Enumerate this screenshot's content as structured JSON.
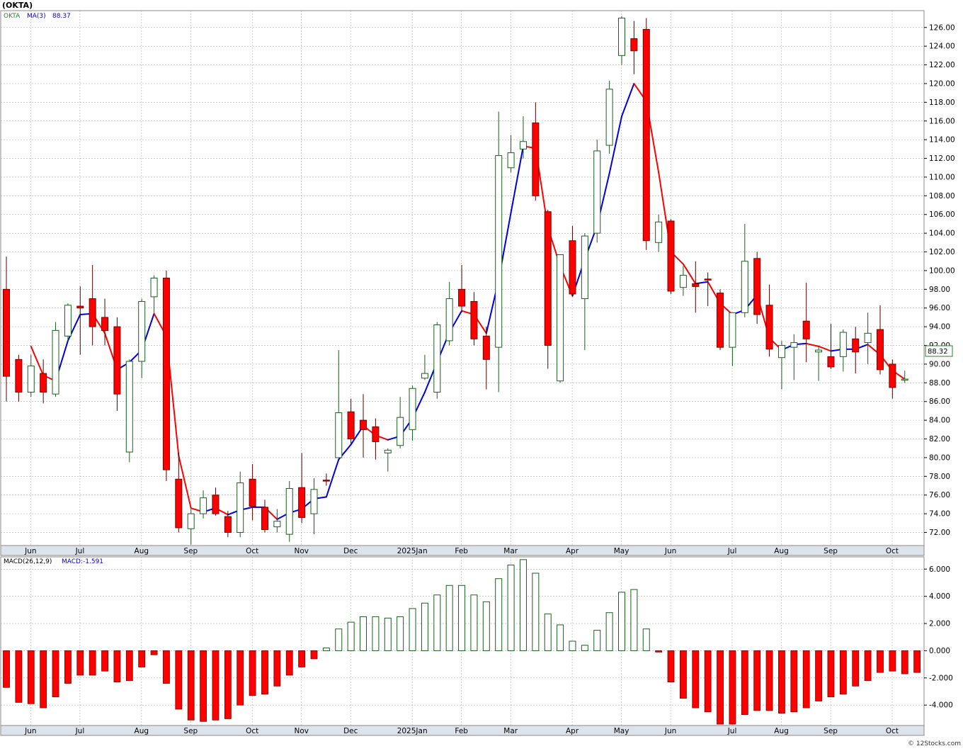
{
  "header": {
    "symbol_title": "(OKTA)"
  },
  "footer": {
    "copyright": "© 12Stocks.com"
  },
  "colors": {
    "up_body_fill": "#ffffff",
    "up_stroke": "#1b5e20",
    "down_fill": "#ff0000",
    "down_stroke": "#7a0000",
    "ma_up": "#0000dd",
    "ma_down": "#ff0000",
    "grid": "#aaaaaa",
    "macd_pos_stroke": "#1b5e20",
    "macd_neg_fill": "#ff0000",
    "price_box": "#2e7d32"
  },
  "chart_data": [
    {
      "type": "candlestick",
      "title": "(OKTA)",
      "legend": {
        "symbol": "OKTA",
        "ma_label": "MA(3)",
        "ma_value": "88.37"
      },
      "last_price_label": "88.32",
      "ylim": [
        70.6,
        127.8
      ],
      "y_ticks": [
        "72.00",
        "74.00",
        "76.00",
        "78.00",
        "80.00",
        "82.00",
        "84.00",
        "86.00",
        "88.00",
        "90.00",
        "92.00",
        "94.00",
        "96.00",
        "98.00",
        "100.00",
        "102.00",
        "104.00",
        "106.00",
        "108.00",
        "110.00",
        "112.00",
        "114.00",
        "116.00",
        "118.00",
        "120.00",
        "122.00",
        "124.00",
        "126.00"
      ],
      "x_labels": [
        {
          "label": "Jun",
          "index": 1
        },
        {
          "label": "Jul",
          "index": 5
        },
        {
          "label": "Aug",
          "index": 10
        },
        {
          "label": "Sep",
          "index": 14
        },
        {
          "label": "Oct",
          "index": 19
        },
        {
          "label": "Nov",
          "index": 23
        },
        {
          "label": "Dec",
          "index": 27
        },
        {
          "label": "2025Jan",
          "index": 32
        },
        {
          "label": "Feb",
          "index": 36
        },
        {
          "label": "Mar",
          "index": 40
        },
        {
          "label": "Apr",
          "index": 45
        },
        {
          "label": "May",
          "index": 49
        },
        {
          "label": "Jun",
          "index": 53
        },
        {
          "label": "Jul",
          "index": 58
        },
        {
          "label": "Aug",
          "index": 62
        },
        {
          "label": "Sep",
          "index": 66
        },
        {
          "label": "Oct",
          "index": 71
        }
      ],
      "candles": [
        {
          "o": 98.0,
          "h": 101.5,
          "l": 86.0,
          "c": 88.7
        },
        {
          "o": 90.5,
          "h": 91.0,
          "l": 86.0,
          "c": 87.0
        },
        {
          "o": 87.0,
          "h": 91.0,
          "l": 86.5,
          "c": 89.8
        },
        {
          "o": 89.0,
          "h": 90.5,
          "l": 85.8,
          "c": 87.0
        },
        {
          "o": 86.8,
          "h": 94.5,
          "l": 86.5,
          "c": 93.6
        },
        {
          "o": 93.0,
          "h": 96.5,
          "l": 92.5,
          "c": 96.3
        },
        {
          "o": 96.2,
          "h": 98.3,
          "l": 91.0,
          "c": 96.0
        },
        {
          "o": 97.0,
          "h": 100.6,
          "l": 92.0,
          "c": 94.0
        },
        {
          "o": 95.0,
          "h": 97.0,
          "l": 92.0,
          "c": 93.6
        },
        {
          "o": 94.0,
          "h": 95.0,
          "l": 85.0,
          "c": 86.8
        },
        {
          "o": 80.6,
          "h": 90.5,
          "l": 79.5,
          "c": 90.3
        },
        {
          "o": 90.3,
          "h": 97.0,
          "l": 88.5,
          "c": 96.7
        },
        {
          "o": 97.2,
          "h": 99.5,
          "l": 95.5,
          "c": 99.2
        },
        {
          "o": 99.2,
          "h": 100.0,
          "l": 77.5,
          "c": 78.7
        },
        {
          "o": 77.7,
          "h": 80.5,
          "l": 72.0,
          "c": 72.5
        },
        {
          "o": 72.4,
          "h": 74.5,
          "l": 70.7,
          "c": 74.0
        },
        {
          "o": 74.0,
          "h": 76.5,
          "l": 73.5,
          "c": 75.7
        },
        {
          "o": 76.0,
          "h": 76.8,
          "l": 73.8,
          "c": 74.0
        },
        {
          "o": 73.7,
          "h": 74.3,
          "l": 71.5,
          "c": 72.0
        },
        {
          "o": 72.0,
          "h": 78.5,
          "l": 71.5,
          "c": 77.3
        },
        {
          "o": 77.7,
          "h": 79.3,
          "l": 73.3,
          "c": 74.8
        },
        {
          "o": 74.7,
          "h": 75.5,
          "l": 72.0,
          "c": 72.3
        },
        {
          "o": 72.6,
          "h": 74.5,
          "l": 72.0,
          "c": 73.2
        },
        {
          "o": 71.8,
          "h": 77.5,
          "l": 71.0,
          "c": 76.7
        },
        {
          "o": 76.8,
          "h": 80.5,
          "l": 73.0,
          "c": 73.6
        },
        {
          "o": 74.0,
          "h": 77.8,
          "l": 71.8,
          "c": 76.6
        },
        {
          "o": 77.6,
          "h": 78.3,
          "l": 77.0,
          "c": 77.5
        },
        {
          "o": 80.0,
          "h": 91.5,
          "l": 80.0,
          "c": 84.8
        },
        {
          "o": 84.9,
          "h": 86.3,
          "l": 81.5,
          "c": 82.0
        },
        {
          "o": 84.0,
          "h": 86.8,
          "l": 80.0,
          "c": 83.0
        },
        {
          "o": 83.3,
          "h": 84.2,
          "l": 79.8,
          "c": 81.7
        },
        {
          "o": 80.5,
          "h": 81.0,
          "l": 78.5,
          "c": 80.8
        },
        {
          "o": 81.3,
          "h": 86.5,
          "l": 81.0,
          "c": 84.3
        },
        {
          "o": 83.0,
          "h": 87.7,
          "l": 81.8,
          "c": 87.4
        },
        {
          "o": 88.5,
          "h": 91.0,
          "l": 88.3,
          "c": 89.0
        },
        {
          "o": 87.0,
          "h": 94.5,
          "l": 86.3,
          "c": 94.2
        },
        {
          "o": 92.5,
          "h": 98.8,
          "l": 92.0,
          "c": 97.0
        },
        {
          "o": 98.0,
          "h": 100.6,
          "l": 95.5,
          "c": 96.2
        },
        {
          "o": 96.7,
          "h": 97.7,
          "l": 92.0,
          "c": 92.7
        },
        {
          "o": 93.0,
          "h": 94.0,
          "l": 87.3,
          "c": 90.5
        },
        {
          "o": 91.8,
          "h": 117.0,
          "l": 87.0,
          "c": 112.3
        },
        {
          "o": 111.0,
          "h": 114.5,
          "l": 110.5,
          "c": 112.6
        },
        {
          "o": 113.0,
          "h": 116.5,
          "l": 112.0,
          "c": 113.8
        },
        {
          "o": 115.8,
          "h": 118.0,
          "l": 107.5,
          "c": 108.0
        },
        {
          "o": 106.3,
          "h": 106.5,
          "l": 89.5,
          "c": 92.0
        },
        {
          "o": 88.2,
          "h": 101.5,
          "l": 88.0,
          "c": 101.7
        },
        {
          "o": 103.2,
          "h": 104.8,
          "l": 97.2,
          "c": 97.5
        },
        {
          "o": 97.0,
          "h": 104.0,
          "l": 91.5,
          "c": 103.7
        },
        {
          "o": 104.0,
          "h": 114.0,
          "l": 103.0,
          "c": 112.8
        },
        {
          "o": 113.4,
          "h": 120.3,
          "l": 112.5,
          "c": 119.4
        },
        {
          "o": 123.0,
          "h": 127.2,
          "l": 122.0,
          "c": 127.0
        },
        {
          "o": 124.8,
          "h": 126.7,
          "l": 121.0,
          "c": 123.5
        },
        {
          "o": 125.8,
          "h": 127.0,
          "l": 102.2,
          "c": 103.2
        },
        {
          "o": 103.0,
          "h": 106.0,
          "l": 102.0,
          "c": 105.2
        },
        {
          "o": 105.3,
          "h": 105.5,
          "l": 97.5,
          "c": 97.8
        },
        {
          "o": 98.2,
          "h": 100.5,
          "l": 97.3,
          "c": 99.5
        },
        {
          "o": 98.6,
          "h": 101.0,
          "l": 95.5,
          "c": 98.3
        },
        {
          "o": 99.1,
          "h": 99.8,
          "l": 96.2,
          "c": 99.0
        },
        {
          "o": 97.6,
          "h": 98.0,
          "l": 91.5,
          "c": 91.8
        },
        {
          "o": 91.8,
          "h": 95.2,
          "l": 89.8,
          "c": 95.5
        },
        {
          "o": 95.5,
          "h": 105.0,
          "l": 95.0,
          "c": 101.0
        },
        {
          "o": 101.3,
          "h": 102.0,
          "l": 94.3,
          "c": 95.3
        },
        {
          "o": 96.3,
          "h": 98.5,
          "l": 90.8,
          "c": 91.6
        },
        {
          "o": 90.7,
          "h": 92.5,
          "l": 87.3,
          "c": 92.0
        },
        {
          "o": 91.8,
          "h": 93.2,
          "l": 88.3,
          "c": 92.3
        },
        {
          "o": 94.6,
          "h": 98.7,
          "l": 90.2,
          "c": 92.7
        },
        {
          "o": 91.3,
          "h": 92.0,
          "l": 88.2,
          "c": 91.5
        },
        {
          "o": 90.8,
          "h": 94.3,
          "l": 89.5,
          "c": 89.7
        },
        {
          "o": 90.8,
          "h": 93.7,
          "l": 89.2,
          "c": 93.4
        },
        {
          "o": 92.7,
          "h": 94.0,
          "l": 89.0,
          "c": 91.3
        },
        {
          "o": 92.3,
          "h": 95.5,
          "l": 90.0,
          "c": 93.3
        },
        {
          "o": 93.7,
          "h": 96.3,
          "l": 88.9,
          "c": 89.4
        },
        {
          "o": 90.0,
          "h": 90.5,
          "l": 86.3,
          "c": 87.5
        },
        {
          "o": 88.3,
          "h": 89.3,
          "l": 88.0,
          "c": 88.4
        }
      ],
      "ma": [
        null,
        null,
        91.9,
        88.8,
        88.2,
        92.5,
        95.3,
        95.4,
        93.3,
        89.4,
        90.2,
        91.5,
        95.4,
        93.0,
        80.2,
        74.6,
        74.2,
        74.6,
        73.9,
        74.4,
        74.7,
        74.7,
        73.4,
        74.1,
        74.5,
        75.6,
        75.8,
        79.8,
        81.4,
        83.4,
        82.4,
        81.9,
        82.3,
        84.2,
        87.0,
        90.2,
        93.4,
        95.7,
        95.3,
        93.3,
        99.0,
        106.2,
        113.3,
        113.1,
        104.6,
        100.5,
        97.3,
        101.2,
        104.8,
        110.4,
        116.5,
        120.0,
        118.1,
        110.5,
        102.0,
        100.7,
        98.6,
        98.8,
        96.5,
        95.3,
        95.8,
        97.4,
        92.8,
        91.5,
        92.1,
        92.2,
        91.9,
        91.4,
        91.6,
        91.6,
        92.1,
        91.0,
        89.3,
        88.4
      ]
    },
    {
      "type": "bar",
      "title": "",
      "legend": {
        "label": "MACD(26,12,9)",
        "value_label": "MACD:-1.591"
      },
      "ylim": [
        -5.5,
        6.9
      ],
      "y_ticks": [
        "6.000",
        "4.000",
        "2.000",
        "0.000",
        "-2.000",
        "-4.000"
      ],
      "values": [
        -2.7,
        -3.8,
        -3.9,
        -4.2,
        -3.4,
        -2.4,
        -1.8,
        -1.8,
        -1.5,
        -2.3,
        -2.2,
        -1.2,
        -0.3,
        -2.4,
        -4.3,
        -5.1,
        -5.2,
        -5.1,
        -5.0,
        -4.0,
        -3.3,
        -3.2,
        -2.6,
        -1.8,
        -1.2,
        -0.6,
        0.2,
        1.6,
        2.1,
        2.5,
        2.5,
        2.4,
        2.5,
        3.1,
        3.5,
        4.1,
        4.8,
        4.8,
        4.1,
        3.6,
        5.3,
        6.3,
        6.7,
        5.7,
        2.7,
        1.9,
        0.7,
        0.4,
        1.5,
        2.8,
        4.3,
        4.5,
        1.6,
        -0.1,
        -2.3,
        -3.5,
        -4.2,
        -4.5,
        -5.4,
        -5.4,
        -4.7,
        -4.4,
        -4.4,
        -4.6,
        -4.5,
        -4.2,
        -3.7,
        -3.4,
        -3.2,
        -2.6,
        -2.2,
        -1.6,
        -1.5,
        -1.7,
        -1.6
      ]
    }
  ]
}
